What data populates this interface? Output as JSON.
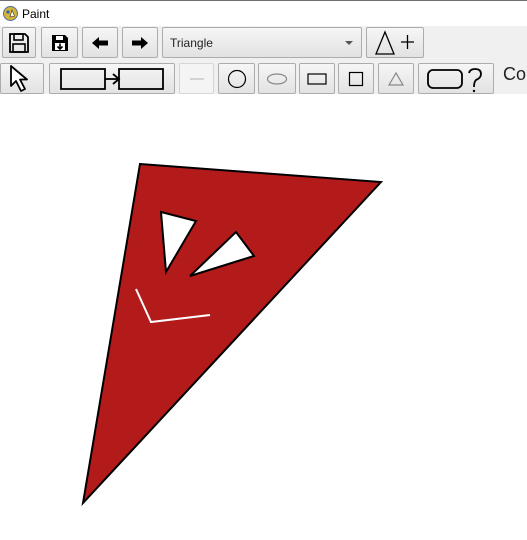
{
  "window": {
    "title": "Paint",
    "icon": "paint-app-icon"
  },
  "toolbar_row1": {
    "buttons": [
      {
        "name": "save-button",
        "icon": "floppy-disk-icon"
      },
      {
        "name": "save-as-button",
        "icon": "floppy-disk-arrow-icon"
      },
      {
        "name": "undo-button",
        "icon": "arrow-left-icon"
      },
      {
        "name": "redo-button",
        "icon": "arrow-right-icon"
      }
    ],
    "shape_select": {
      "selected": "Triangle"
    },
    "add_shape_button": {
      "icon": "triangle-plus-icon"
    }
  },
  "toolbar_row2": {
    "tools": [
      {
        "name": "select-tool-button",
        "icon": "cursor-arrow-icon",
        "enabled": true
      },
      {
        "name": "connector-tool-button",
        "icon": "connector-icon",
        "enabled": true
      },
      {
        "name": "line-tool-button",
        "icon": "line-icon",
        "enabled": false
      },
      {
        "name": "circle-tool-button",
        "icon": "circle-icon",
        "enabled": true
      },
      {
        "name": "ellipse-tool-button",
        "icon": "ellipse-icon",
        "enabled": true
      },
      {
        "name": "rectangle-tool-button",
        "icon": "rectangle-icon",
        "enabled": true
      },
      {
        "name": "square-tool-button",
        "icon": "square-icon",
        "enabled": true
      },
      {
        "name": "triangle-tool-button",
        "icon": "triangle-icon",
        "enabled": true
      },
      {
        "name": "custom-shape-button",
        "icon": "rounded-rect-question-icon",
        "enabled": true
      }
    ],
    "truncated_label": "Co"
  },
  "canvas": {
    "drawing": {
      "fill": "#b31b1b",
      "stroke": "#000000",
      "detail_color": "#ffffff"
    }
  }
}
